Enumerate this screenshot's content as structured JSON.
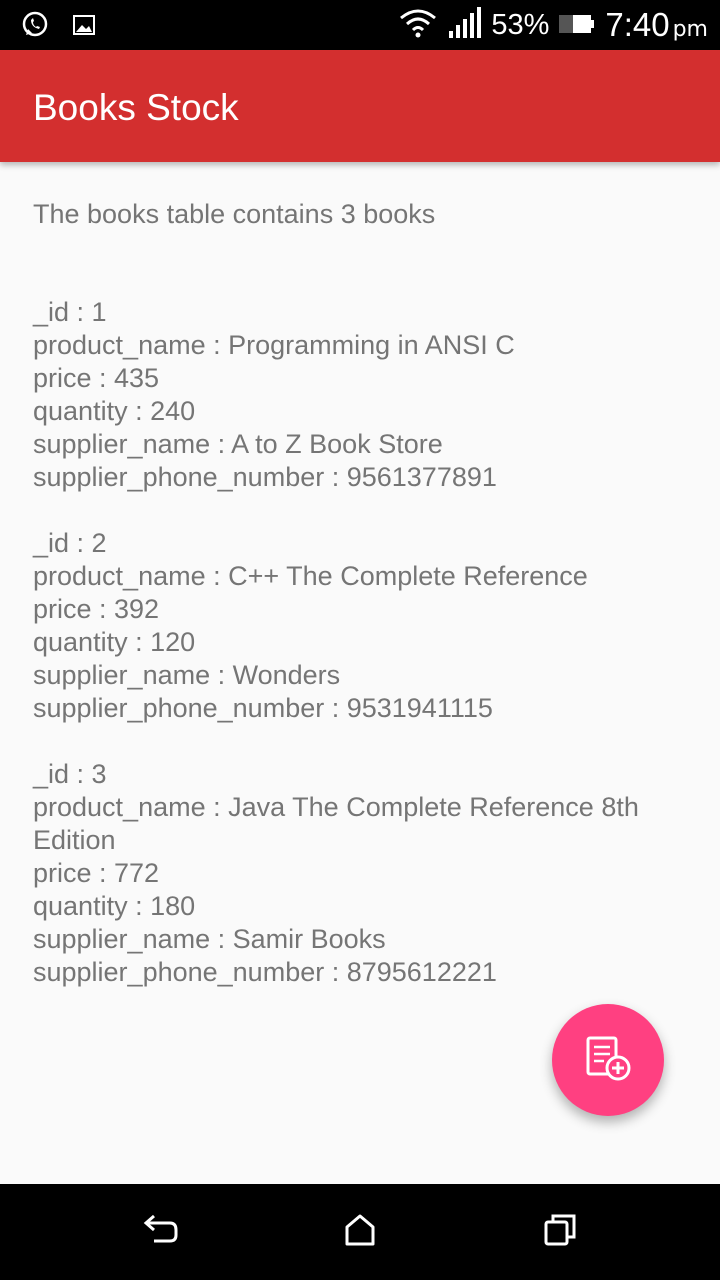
{
  "status_bar": {
    "battery_percent": "53%",
    "time": "7:40",
    "time_suffix": "pm",
    "icons": [
      "whatsapp-icon",
      "image-icon",
      "wifi-icon",
      "signal-icon",
      "battery-icon"
    ]
  },
  "app_bar": {
    "title": "Books Stock",
    "color": "#d32f2f"
  },
  "content": {
    "summary": "The books table contains 3 books",
    "records": [
      {
        "id": "_id  : 1",
        "product_name": "product_name  : Programming in ANSI C",
        "price": "price  : 435",
        "quantity": "quantity  : 240",
        "supplier_name": "supplier_name  : A to Z Book Store",
        "supplier_phone": "supplier_phone_number  : 9561377891"
      },
      {
        "id": "_id  : 2",
        "product_name": "product_name  : C++ The Complete Reference",
        "price": "price  : 392",
        "quantity": "quantity  : 120",
        "supplier_name": "supplier_name  : Wonders",
        "supplier_phone": "supplier_phone_number  : 9531941115"
      },
      {
        "id": "_id  : 3",
        "product_name": "product_name  : Java The Complete Reference 8th Edition",
        "price": "price  : 772",
        "quantity": "quantity  : 180",
        "supplier_name": "supplier_name  : Samir Books",
        "supplier_phone": "supplier_phone_number  : 8795612221"
      }
    ]
  },
  "fab": {
    "icon": "add-book-icon",
    "color": "#ff4081"
  },
  "nav_bar": {
    "icons": [
      "back-icon",
      "home-icon",
      "recents-icon"
    ]
  }
}
